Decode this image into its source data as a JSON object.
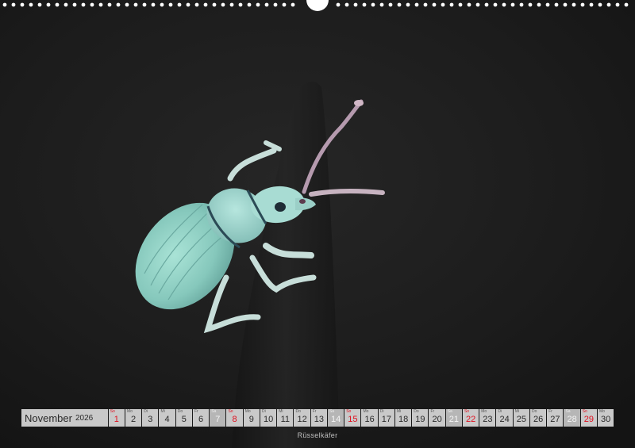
{
  "calendar": {
    "month": "November",
    "year": "2026",
    "days": [
      {
        "wd": "So",
        "num": "1",
        "type": "sun"
      },
      {
        "wd": "Mo",
        "num": "2",
        "type": "weekday"
      },
      {
        "wd": "Di",
        "num": "3",
        "type": "weekday"
      },
      {
        "wd": "Mi",
        "num": "4",
        "type": "weekday"
      },
      {
        "wd": "Do",
        "num": "5",
        "type": "weekday"
      },
      {
        "wd": "Fr",
        "num": "6",
        "type": "weekday"
      },
      {
        "wd": "Sa",
        "num": "7",
        "type": "sat"
      },
      {
        "wd": "So",
        "num": "8",
        "type": "sun"
      },
      {
        "wd": "Mo",
        "num": "9",
        "type": "weekday"
      },
      {
        "wd": "Di",
        "num": "10",
        "type": "weekday"
      },
      {
        "wd": "Mi",
        "num": "11",
        "type": "weekday"
      },
      {
        "wd": "Do",
        "num": "12",
        "type": "weekday"
      },
      {
        "wd": "Fr",
        "num": "13",
        "type": "weekday"
      },
      {
        "wd": "Sa",
        "num": "14",
        "type": "sat"
      },
      {
        "wd": "So",
        "num": "15",
        "type": "sun"
      },
      {
        "wd": "Mo",
        "num": "16",
        "type": "weekday"
      },
      {
        "wd": "Di",
        "num": "17",
        "type": "weekday"
      },
      {
        "wd": "Mi",
        "num": "18",
        "type": "weekday"
      },
      {
        "wd": "Do",
        "num": "19",
        "type": "weekday"
      },
      {
        "wd": "Fr",
        "num": "20",
        "type": "weekday"
      },
      {
        "wd": "Sa",
        "num": "21",
        "type": "sat"
      },
      {
        "wd": "So",
        "num": "22",
        "type": "sun"
      },
      {
        "wd": "Mo",
        "num": "23",
        "type": "weekday"
      },
      {
        "wd": "Di",
        "num": "24",
        "type": "weekday"
      },
      {
        "wd": "Mi",
        "num": "25",
        "type": "weekday"
      },
      {
        "wd": "Do",
        "num": "26",
        "type": "weekday"
      },
      {
        "wd": "Fr",
        "num": "27",
        "type": "weekday"
      },
      {
        "wd": "Sa",
        "num": "28",
        "type": "sat"
      },
      {
        "wd": "So",
        "num": "29",
        "type": "sun"
      },
      {
        "wd": "Mo",
        "num": "30",
        "type": "weekday"
      }
    ]
  },
  "caption": "Rüsselkäfer",
  "photo": {
    "subject_icon": "weevil-beetle-icon",
    "background_color": "#1b1b1b",
    "beetle_color": "#8fd0c4"
  },
  "colors": {
    "calendar_cell": "#c9c9c9",
    "saturday_cell": "#b6b6b6",
    "sunday_text": "#e0101f"
  }
}
